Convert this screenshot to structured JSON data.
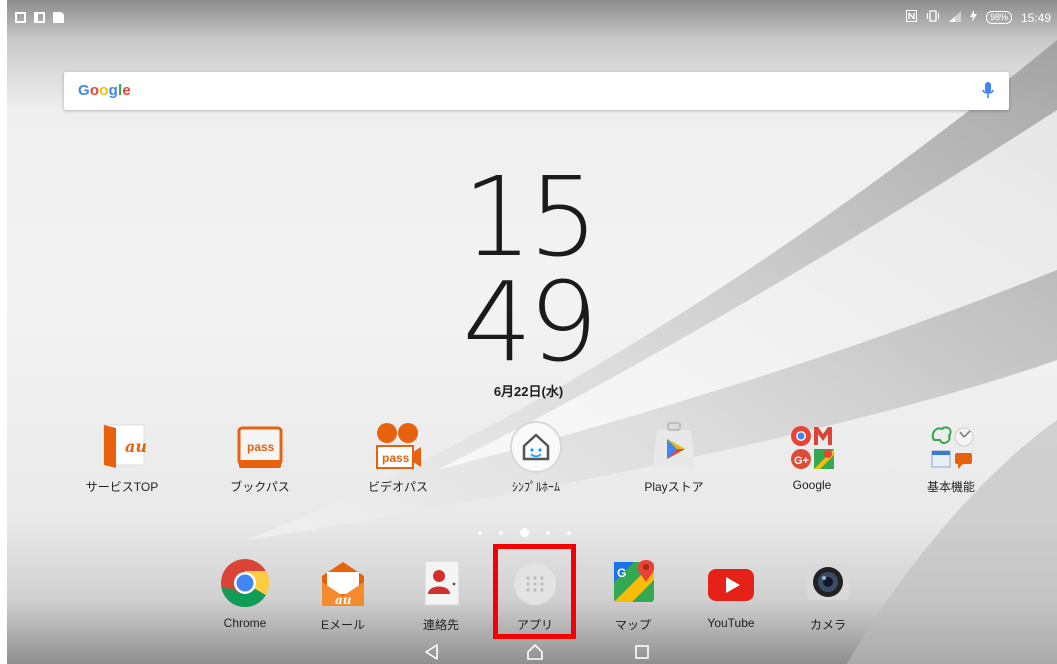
{
  "status_bar": {
    "battery": "98%",
    "time": "15:49"
  },
  "search": {
    "brand": "Google"
  },
  "clock": {
    "hour": "15",
    "minute": "49",
    "date": "6月22日(水)"
  },
  "home_apps": [
    {
      "label": "サービスTOP",
      "icon": "au-service-top-icon"
    },
    {
      "label": "ブックパス",
      "icon": "book-pass-icon"
    },
    {
      "label": "ビデオパス",
      "icon": "video-pass-icon"
    },
    {
      "label": "ｼﾝﾌﾟﾙﾎｰﾑ",
      "icon": "simple-home-icon"
    },
    {
      "label": "Playストア",
      "icon": "play-store-icon"
    },
    {
      "label": "Google",
      "icon": "google-folder-icon"
    },
    {
      "label": "基本機能",
      "icon": "basic-functions-folder-icon"
    }
  ],
  "dock_apps": [
    {
      "label": "Chrome",
      "icon": "chrome-icon"
    },
    {
      "label": "Eメール",
      "icon": "email-icon"
    },
    {
      "label": "連絡先",
      "icon": "contacts-icon"
    },
    {
      "label": "アプリ",
      "icon": "app-drawer-icon"
    },
    {
      "label": "マップ",
      "icon": "maps-icon"
    },
    {
      "label": "YouTube",
      "icon": "youtube-icon"
    },
    {
      "label": "カメラ",
      "icon": "camera-icon"
    }
  ],
  "page_indicator": {
    "pages": 5,
    "current": 3
  },
  "colors": {
    "highlight": "#f50000",
    "au_orange": "#e8620e",
    "youtube_red": "#e62117"
  }
}
